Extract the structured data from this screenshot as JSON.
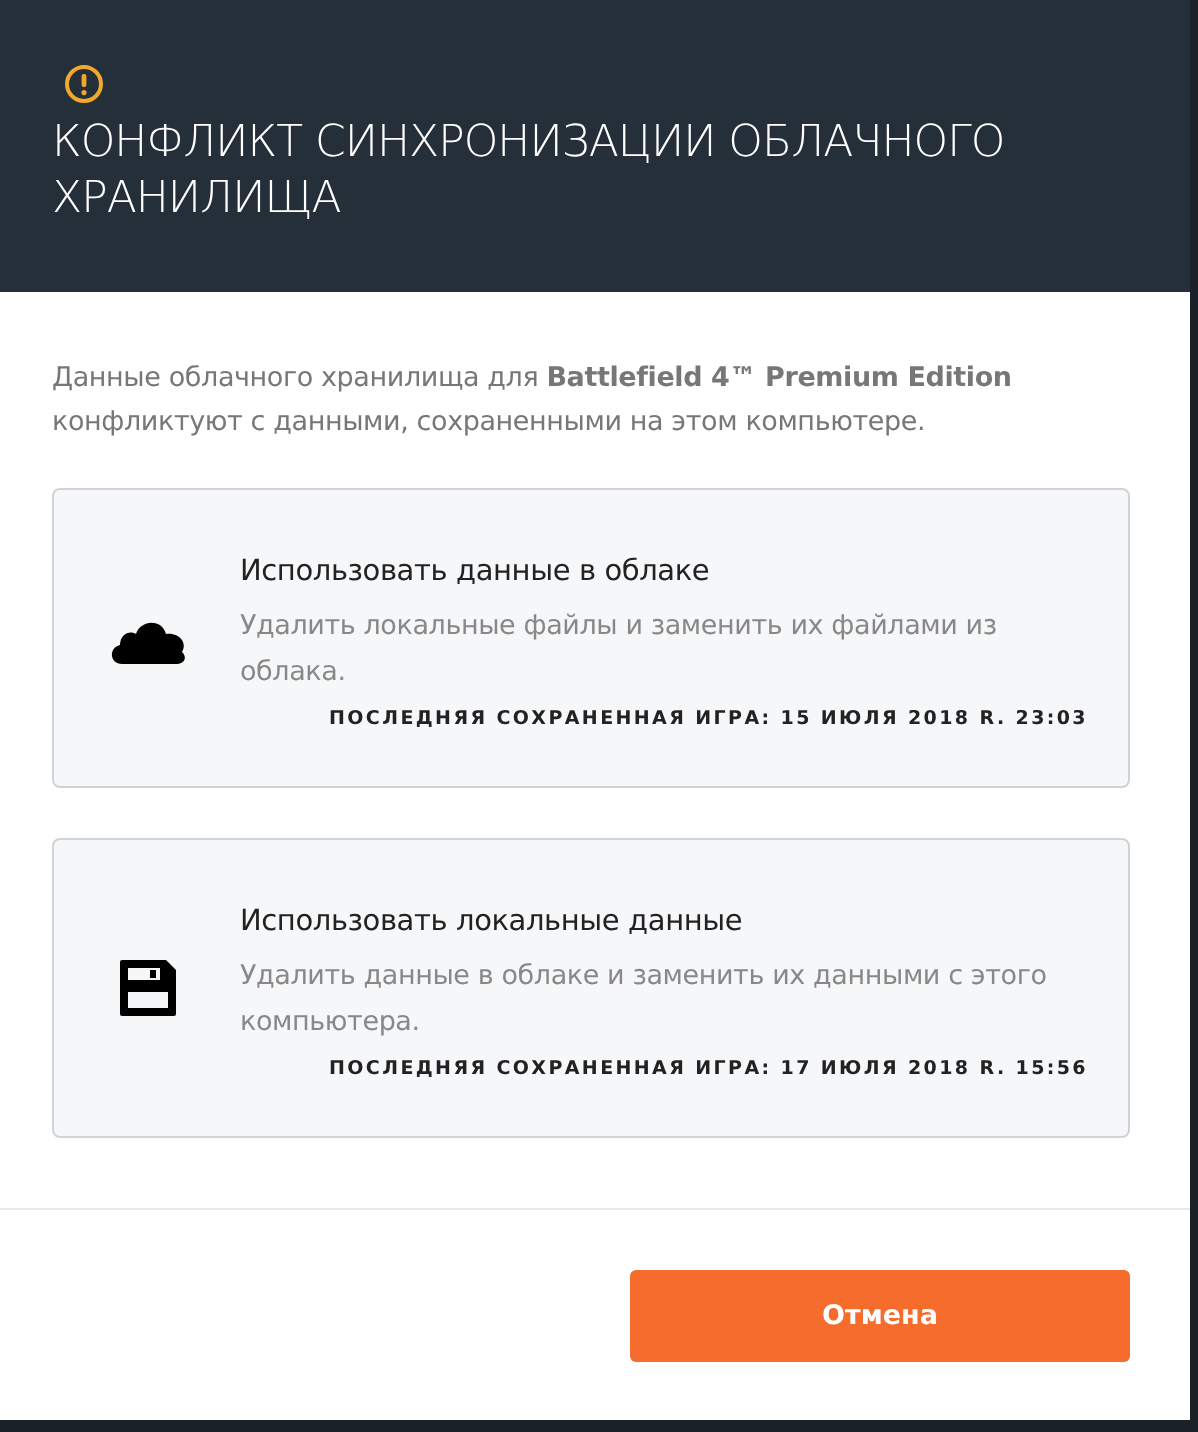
{
  "dialog": {
    "title": "КОНФЛИКТ СИНХРОНИЗАЦИИ ОБЛАЧНОГО ХРАНИЛИЩА",
    "message": "Данные облачного хранилища для **Battlefield 4™ Premium Edition** конфликтуют с данными, сохраненными на этом компьютере.",
    "options": [
      {
        "kind": "cloud",
        "title": "Использовать данные в облаке",
        "description": "Удалить локальные файлы и заменить их файлами из облака.",
        "last_save": "ПОСЛЕДНЯЯ СОХРАНЕННАЯ ИГРА: 15 ИЮЛЯ 2018 R. 23:03"
      },
      {
        "kind": "local",
        "title": "Использовать локальные данные",
        "description": "Удалить данные в облаке и заменить их данными с этого компьютера.",
        "last_save": "ПОСЛЕДНЯЯ СОХРАНЕННАЯ ИГРА: 17 ИЮЛЯ 2018 R. 15:56"
      }
    ],
    "cancel_button": "Отмена"
  }
}
